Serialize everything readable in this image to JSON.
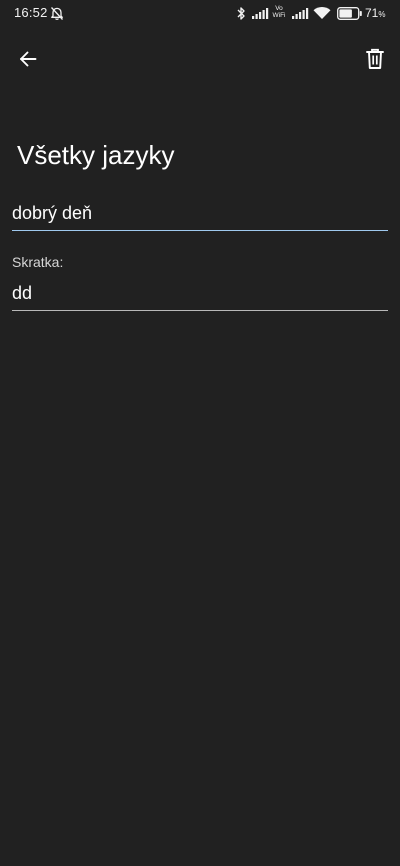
{
  "status_bar": {
    "time": "16:52",
    "vowifi_top": "Vo",
    "vowifi_bottom": "WiFi",
    "battery_level": 71,
    "battery_text": "71",
    "battery_unit": "%",
    "icons": [
      "mute-bell-icon",
      "bluetooth-icon",
      "signal-icon",
      "wifi-icon",
      "battery-icon"
    ]
  },
  "app_bar": {
    "back_icon": "arrow-left-icon",
    "delete_icon": "trash-icon"
  },
  "page": {
    "title": "Všetky jazyky"
  },
  "form": {
    "name_value": "dobrý deň",
    "abbreviation_label": "Skratka:",
    "abbreviation_value": "dd"
  },
  "colors": {
    "background": "#212121",
    "accent_underline": "#9fc9ee",
    "text": "#ffffff"
  }
}
